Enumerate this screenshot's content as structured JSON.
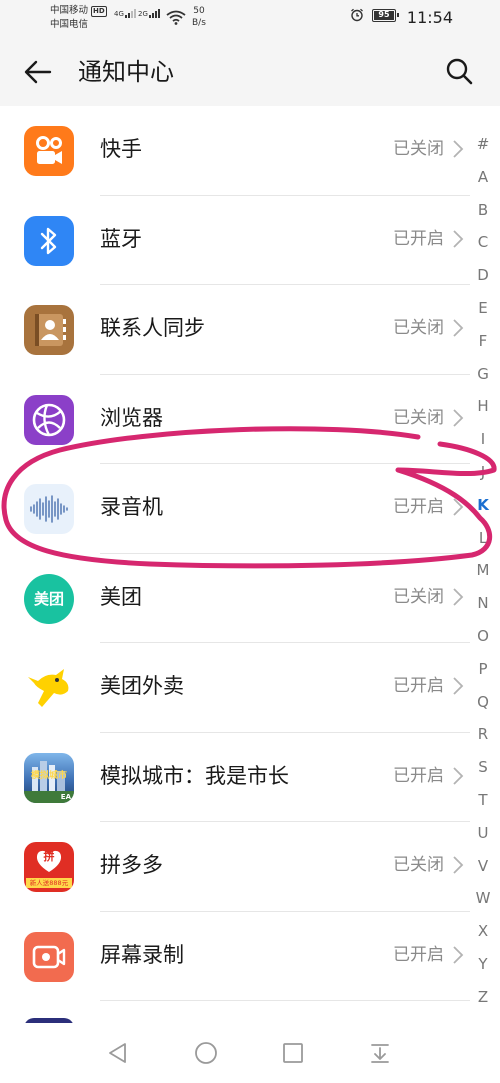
{
  "status_bar": {
    "carrier1": "中国移动",
    "carrier1_badge": "HD",
    "carrier2": "中国电信",
    "sig1_label": "4G",
    "sig2_label": "2G",
    "net_speed_value": "50",
    "net_speed_unit": "B/s",
    "battery": "95",
    "time": "11:54",
    "icons": [
      "alarm-icon",
      "wifi-icon",
      "battery-icon"
    ]
  },
  "header": {
    "title": "通知中心",
    "back_icon": "arrow-left-icon",
    "search_icon": "search-icon"
  },
  "apps": [
    {
      "name": "快手",
      "status": "已关闭",
      "icon": "kuaishou-icon",
      "color": "#ff7a1a"
    },
    {
      "name": "蓝牙",
      "status": "已开启",
      "icon": "bluetooth-icon",
      "color": "#2f86f5"
    },
    {
      "name": "联系人同步",
      "status": "已关闭",
      "icon": "contacts-sync-icon",
      "color": "#a8733d"
    },
    {
      "name": "浏览器",
      "status": "已关闭",
      "icon": "browser-icon",
      "color": "#8b3fc8"
    },
    {
      "name": "录音机",
      "status": "已开启",
      "icon": "recorder-icon",
      "color": "#e8f1fb"
    },
    {
      "name": "美团",
      "status": "已关闭",
      "icon": "meituan-icon",
      "color": "#19c2a0",
      "icon_text": "美团"
    },
    {
      "name": "美团外卖",
      "status": "已开启",
      "icon": "meituan-waimai-icon",
      "color": "#ffd100"
    },
    {
      "name": "模拟城市：我是市长",
      "status": "已开启",
      "icon": "simcity-icon",
      "color": "#5a8fd1",
      "icon_text": "模拟城市",
      "icon_subtext": "EA"
    },
    {
      "name": "拼多多",
      "status": "已关闭",
      "icon": "pinduoduo-icon",
      "color": "#e02e24",
      "icon_text": "拼",
      "icon_subtext": "新人送888元"
    },
    {
      "name": "屏幕录制",
      "status": "已开启",
      "icon": "screen-record-icon",
      "color": "#f26b4f"
    }
  ],
  "alphabet": [
    "#",
    "A",
    "B",
    "C",
    "D",
    "E",
    "F",
    "G",
    "H",
    "I",
    "J",
    "K",
    "L",
    "M",
    "N",
    "O",
    "P",
    "Q",
    "R",
    "S",
    "T",
    "U",
    "V",
    "W",
    "X",
    "Y",
    "Z"
  ],
  "alphabet_active": "K",
  "annotation_color": "#d6276f",
  "nav": [
    "back-triangle-icon",
    "home-circle-icon",
    "recents-square-icon",
    "notification-pull-icon"
  ]
}
